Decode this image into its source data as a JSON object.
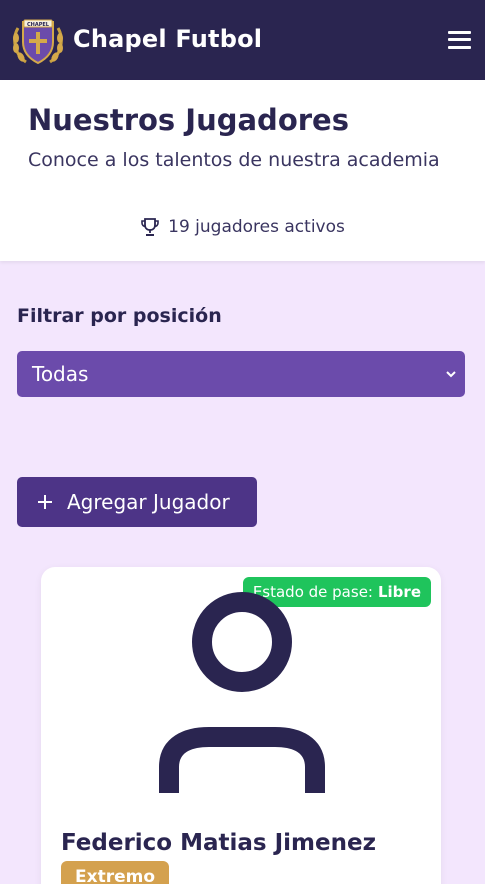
{
  "navbar": {
    "brand": "Chapel Futbol",
    "logo_text": "CHAPEL",
    "menu_icon": "hamburger-menu-icon"
  },
  "header": {
    "title": "Nuestros Jugadores",
    "subtitle": "Conoce a los talentos de nuestra academia",
    "active_count_label": "19 jugadores activos",
    "active_count_icon": "trophy-icon"
  },
  "filter": {
    "label": "Filtrar por posición",
    "selected": "Todas"
  },
  "actions": {
    "add_player_label": "Agregar Jugador"
  },
  "players": [
    {
      "status_prefix": "Estado de pase:",
      "status_value": "Libre",
      "name": "Federico Matias Jimenez",
      "position": "Extremo"
    }
  ],
  "colors": {
    "navbar": "#2a2550",
    "page_background": "#f3e6fd",
    "select": "#6b4bab",
    "add_button": "#4d3487",
    "status_badge": "#1fc45c",
    "position_badge": "#d4a14e"
  }
}
